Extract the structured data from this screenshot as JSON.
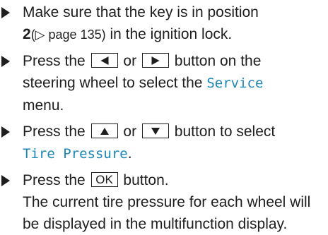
{
  "steps": [
    {
      "parts": {
        "a": "Make sure that the key is in position",
        "position": "2",
        "ref_symbol": "(▷ page 135)",
        "b": " in the ignition lock."
      }
    },
    {
      "parts": {
        "a": "Press the",
        "or": "or",
        "b": "button on the",
        "c": "steering wheel to select the",
        "menu": "Service",
        "d": "menu."
      }
    },
    {
      "parts": {
        "a": "Press the",
        "or": "or",
        "b": "button to select",
        "menu": "Tire Pressure",
        "period": "."
      }
    },
    {
      "parts": {
        "a": "Press the",
        "key": "OK",
        "b": "button.",
        "c": "The current tire pressure for each wheel will",
        "d": "be displayed in the multifunction display."
      }
    }
  ],
  "icons": {
    "bullet": "right-triangle-bullet-icon",
    "left_key": "left-arrow-key-icon",
    "right_key": "right-arrow-key-icon",
    "up_key": "up-arrow-key-icon",
    "down_key": "down-arrow-key-icon",
    "ok_key": "ok-key-icon"
  },
  "colors": {
    "text": "#1e1e1e",
    "menu_text": "#1a86b5"
  }
}
